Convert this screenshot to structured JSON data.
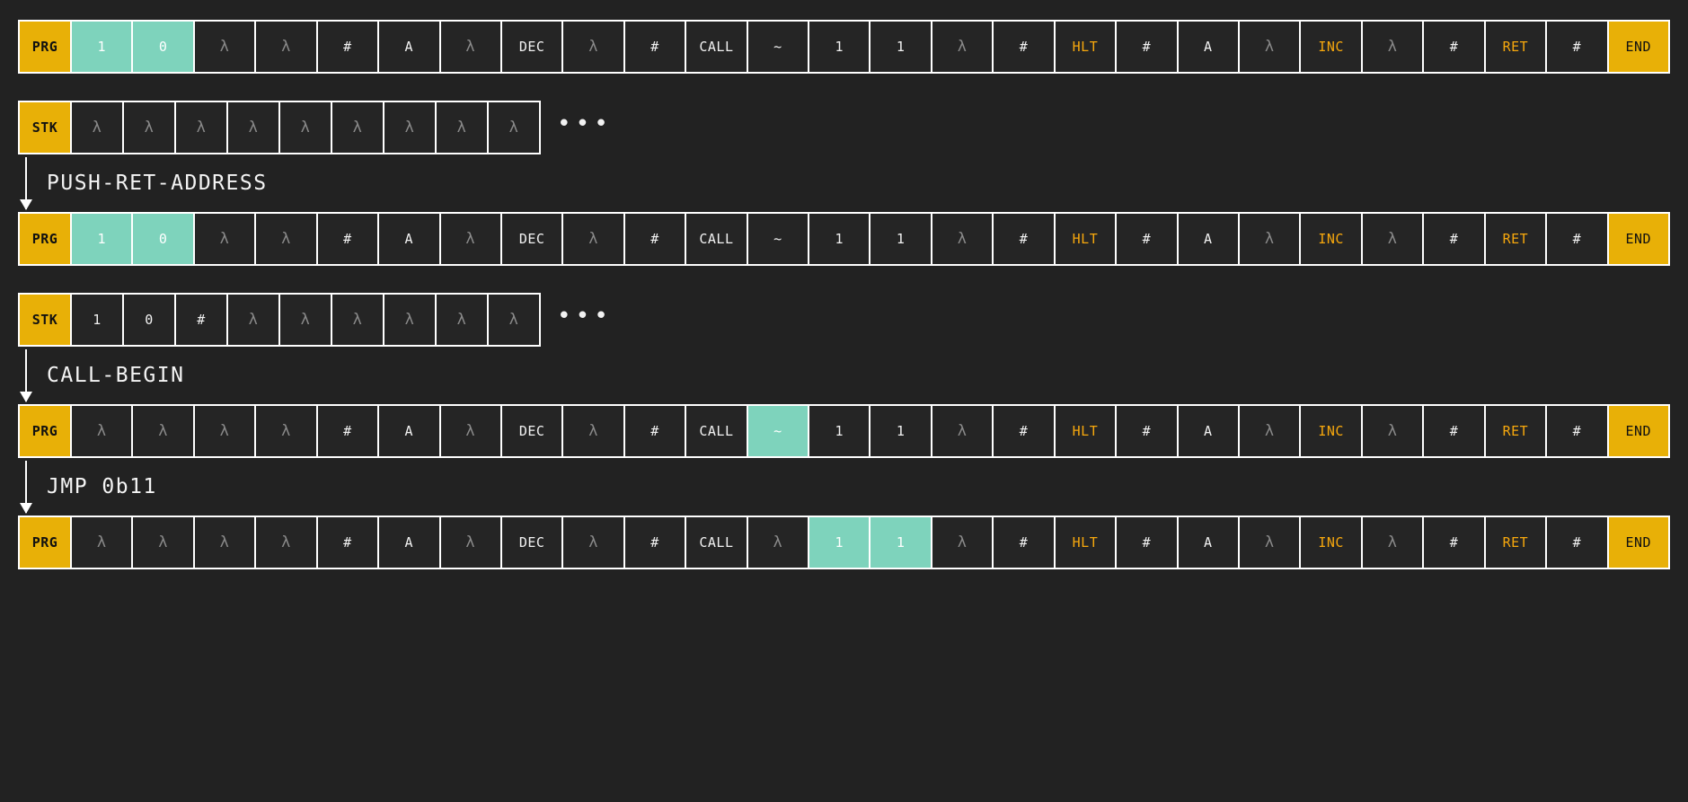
{
  "theme": {
    "background": "#222222",
    "cell_background": "#252525",
    "cell_border": "#ffffff",
    "label_gold": "#e8b007",
    "highlight_teal": "#7ed3bc",
    "keyword_orange": "#f7a80d",
    "lambda_gray": "#8a8a8a",
    "text": "#f2f2f2"
  },
  "labels": {
    "program": "PRG",
    "stack": "STK",
    "ellipsis": "•••"
  },
  "steps": [
    {
      "id": "push-ret-address",
      "label": "PUSH-RET-ADDRESS"
    },
    {
      "id": "call-begin",
      "label": "CALL-BEGIN"
    },
    {
      "id": "jmp",
      "label": "JMP 0b11"
    }
  ],
  "frames": [
    {
      "id": "frame-0",
      "program": {
        "label": "PRG",
        "cells": [
          {
            "text": "1",
            "style": "hl"
          },
          {
            "text": "0",
            "style": "hl"
          },
          {
            "text": "λ",
            "style": "lam"
          },
          {
            "text": "λ",
            "style": "lam"
          },
          {
            "text": "#",
            "style": "plain"
          },
          {
            "text": "A",
            "style": "plain"
          },
          {
            "text": "λ",
            "style": "lam"
          },
          {
            "text": "DEC",
            "style": "plain"
          },
          {
            "text": "λ",
            "style": "lam"
          },
          {
            "text": "#",
            "style": "plain"
          },
          {
            "text": "CALL",
            "style": "plain"
          },
          {
            "text": "~",
            "style": "plain"
          },
          {
            "text": "1",
            "style": "plain"
          },
          {
            "text": "1",
            "style": "plain"
          },
          {
            "text": "λ",
            "style": "lam"
          },
          {
            "text": "#",
            "style": "plain"
          },
          {
            "text": "HLT",
            "style": "kw"
          },
          {
            "text": "#",
            "style": "plain"
          },
          {
            "text": "A",
            "style": "plain"
          },
          {
            "text": "λ",
            "style": "lam"
          },
          {
            "text": "INC",
            "style": "kw"
          },
          {
            "text": "λ",
            "style": "lam"
          },
          {
            "text": "#",
            "style": "plain"
          },
          {
            "text": "RET",
            "style": "kw"
          },
          {
            "text": "#",
            "style": "plain"
          },
          {
            "text": "END",
            "style": "end"
          }
        ]
      },
      "stack": {
        "label": "STK",
        "cells": [
          {
            "text": "λ",
            "style": "lam"
          },
          {
            "text": "λ",
            "style": "lam"
          },
          {
            "text": "λ",
            "style": "lam"
          },
          {
            "text": "λ",
            "style": "lam"
          },
          {
            "text": "λ",
            "style": "lam"
          },
          {
            "text": "λ",
            "style": "lam"
          },
          {
            "text": "λ",
            "style": "lam"
          },
          {
            "text": "λ",
            "style": "lam"
          },
          {
            "text": "λ",
            "style": "lam"
          }
        ],
        "truncated": true
      }
    },
    {
      "id": "frame-1",
      "program": {
        "label": "PRG",
        "cells": [
          {
            "text": "1",
            "style": "hl"
          },
          {
            "text": "0",
            "style": "hl"
          },
          {
            "text": "λ",
            "style": "lam"
          },
          {
            "text": "λ",
            "style": "lam"
          },
          {
            "text": "#",
            "style": "plain"
          },
          {
            "text": "A",
            "style": "plain"
          },
          {
            "text": "λ",
            "style": "lam"
          },
          {
            "text": "DEC",
            "style": "plain"
          },
          {
            "text": "λ",
            "style": "lam"
          },
          {
            "text": "#",
            "style": "plain"
          },
          {
            "text": "CALL",
            "style": "plain"
          },
          {
            "text": "~",
            "style": "plain"
          },
          {
            "text": "1",
            "style": "plain"
          },
          {
            "text": "1",
            "style": "plain"
          },
          {
            "text": "λ",
            "style": "lam"
          },
          {
            "text": "#",
            "style": "plain"
          },
          {
            "text": "HLT",
            "style": "kw"
          },
          {
            "text": "#",
            "style": "plain"
          },
          {
            "text": "A",
            "style": "plain"
          },
          {
            "text": "λ",
            "style": "lam"
          },
          {
            "text": "INC",
            "style": "kw"
          },
          {
            "text": "λ",
            "style": "lam"
          },
          {
            "text": "#",
            "style": "plain"
          },
          {
            "text": "RET",
            "style": "kw"
          },
          {
            "text": "#",
            "style": "plain"
          },
          {
            "text": "END",
            "style": "end"
          }
        ]
      },
      "stack": {
        "label": "STK",
        "cells": [
          {
            "text": "1",
            "style": "plain"
          },
          {
            "text": "0",
            "style": "plain"
          },
          {
            "text": "#",
            "style": "plain"
          },
          {
            "text": "λ",
            "style": "lam"
          },
          {
            "text": "λ",
            "style": "lam"
          },
          {
            "text": "λ",
            "style": "lam"
          },
          {
            "text": "λ",
            "style": "lam"
          },
          {
            "text": "λ",
            "style": "lam"
          },
          {
            "text": "λ",
            "style": "lam"
          }
        ],
        "truncated": true
      }
    },
    {
      "id": "frame-2",
      "program": {
        "label": "PRG",
        "cells": [
          {
            "text": "λ",
            "style": "lam"
          },
          {
            "text": "λ",
            "style": "lam"
          },
          {
            "text": "λ",
            "style": "lam"
          },
          {
            "text": "λ",
            "style": "lam"
          },
          {
            "text": "#",
            "style": "plain"
          },
          {
            "text": "A",
            "style": "plain"
          },
          {
            "text": "λ",
            "style": "lam"
          },
          {
            "text": "DEC",
            "style": "plain"
          },
          {
            "text": "λ",
            "style": "lam"
          },
          {
            "text": "#",
            "style": "plain"
          },
          {
            "text": "CALL",
            "style": "plain"
          },
          {
            "text": "~",
            "style": "hl"
          },
          {
            "text": "1",
            "style": "plain"
          },
          {
            "text": "1",
            "style": "plain"
          },
          {
            "text": "λ",
            "style": "lam"
          },
          {
            "text": "#",
            "style": "plain"
          },
          {
            "text": "HLT",
            "style": "kw"
          },
          {
            "text": "#",
            "style": "plain"
          },
          {
            "text": "A",
            "style": "plain"
          },
          {
            "text": "λ",
            "style": "lam"
          },
          {
            "text": "INC",
            "style": "kw"
          },
          {
            "text": "λ",
            "style": "lam"
          },
          {
            "text": "#",
            "style": "plain"
          },
          {
            "text": "RET",
            "style": "kw"
          },
          {
            "text": "#",
            "style": "plain"
          },
          {
            "text": "END",
            "style": "end"
          }
        ]
      },
      "stack": null
    },
    {
      "id": "frame-3",
      "program": {
        "label": "PRG",
        "cells": [
          {
            "text": "λ",
            "style": "lam"
          },
          {
            "text": "λ",
            "style": "lam"
          },
          {
            "text": "λ",
            "style": "lam"
          },
          {
            "text": "λ",
            "style": "lam"
          },
          {
            "text": "#",
            "style": "plain"
          },
          {
            "text": "A",
            "style": "plain"
          },
          {
            "text": "λ",
            "style": "lam"
          },
          {
            "text": "DEC",
            "style": "plain"
          },
          {
            "text": "λ",
            "style": "lam"
          },
          {
            "text": "#",
            "style": "plain"
          },
          {
            "text": "CALL",
            "style": "plain"
          },
          {
            "text": "λ",
            "style": "lam"
          },
          {
            "text": "1",
            "style": "hl"
          },
          {
            "text": "1",
            "style": "hl"
          },
          {
            "text": "λ",
            "style": "lam"
          },
          {
            "text": "#",
            "style": "plain"
          },
          {
            "text": "HLT",
            "style": "kw"
          },
          {
            "text": "#",
            "style": "plain"
          },
          {
            "text": "A",
            "style": "plain"
          },
          {
            "text": "λ",
            "style": "lam"
          },
          {
            "text": "INC",
            "style": "kw"
          },
          {
            "text": "λ",
            "style": "lam"
          },
          {
            "text": "#",
            "style": "plain"
          },
          {
            "text": "RET",
            "style": "kw"
          },
          {
            "text": "#",
            "style": "plain"
          },
          {
            "text": "END",
            "style": "end"
          }
        ]
      },
      "stack": null
    }
  ]
}
